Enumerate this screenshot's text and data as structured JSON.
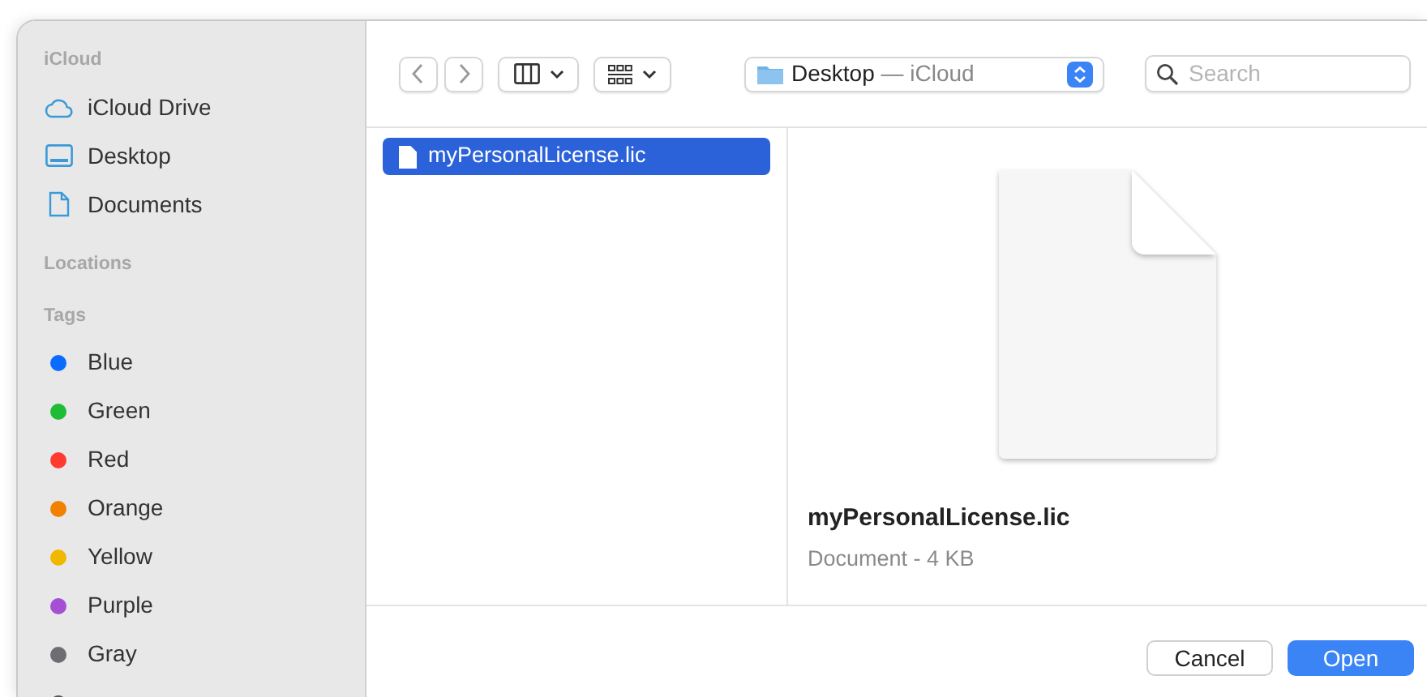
{
  "sidebar": {
    "sections": [
      {
        "title": "iCloud",
        "items": [
          {
            "kind": "location",
            "label": "iCloud Drive"
          },
          {
            "kind": "location",
            "label": "Desktop"
          },
          {
            "kind": "location",
            "label": "Documents"
          }
        ]
      },
      {
        "title": "Locations"
      },
      {
        "title": "Tags",
        "items": [
          {
            "kind": "tag",
            "label": "Blue",
            "color": "#0a6cff"
          },
          {
            "kind": "tag",
            "label": "Green",
            "color": "#1fbd36"
          },
          {
            "kind": "tag",
            "label": "Red",
            "color": "#ff3b30"
          },
          {
            "kind": "tag",
            "label": "Orange",
            "color": "#f08200"
          },
          {
            "kind": "tag",
            "label": "Yellow",
            "color": "#f0b800"
          },
          {
            "kind": "tag",
            "label": "Purple",
            "color": "#a54fd4"
          },
          {
            "kind": "tag",
            "label": "Gray",
            "color": "#6e6e72"
          },
          {
            "kind": "tag"
          }
        ]
      }
    ]
  },
  "toolbar": {
    "location": "Desktop",
    "location_suffix": "— iCloud",
    "search": {
      "placeholder": "Search"
    }
  },
  "files": [
    {
      "name": "myPersonalLicense.lic",
      "selected": true
    }
  ],
  "preview": {
    "name": "myPersonalLicense.lic",
    "details": "Document - 4 KB"
  },
  "buttons": [
    {
      "label": "Cancel",
      "kind": "secondary"
    },
    {
      "label": "Open",
      "kind": "primary"
    }
  ]
}
